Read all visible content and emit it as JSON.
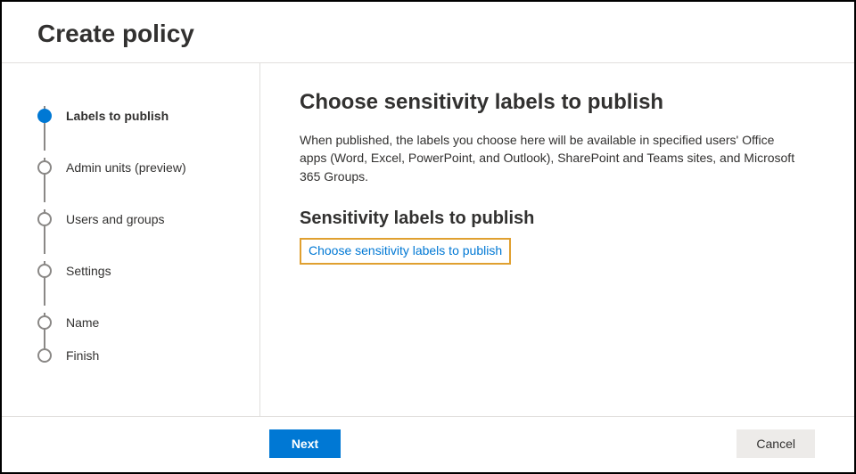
{
  "title": "Create policy",
  "steps": [
    {
      "label": "Labels to publish",
      "active": true
    },
    {
      "label": "Admin units (preview)",
      "active": false
    },
    {
      "label": "Users and groups",
      "active": false
    },
    {
      "label": "Settings",
      "active": false
    },
    {
      "label": "Name",
      "active": false
    },
    {
      "label": "Finish",
      "active": false
    }
  ],
  "main": {
    "heading": "Choose sensitivity labels to publish",
    "description": "When published, the labels you choose here will be available in specified users' Office apps (Word, Excel, PowerPoint, and Outlook), SharePoint and Teams sites, and Microsoft 365 Groups.",
    "subheading": "Sensitivity labels to publish",
    "link_label": "Choose sensitivity labels to publish"
  },
  "footer": {
    "next": "Next",
    "cancel": "Cancel"
  }
}
